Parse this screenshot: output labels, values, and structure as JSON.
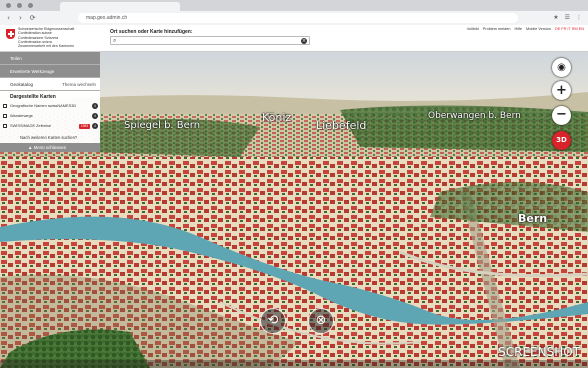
{
  "browser": {
    "url": "map.geo.admin.ch",
    "nav_back": "‹",
    "nav_forward": "›",
    "nav_reload": "⟳",
    "toolbar_icons": [
      "⋮",
      "★",
      "☰"
    ]
  },
  "header": {
    "confederation_lines": [
      "Schweizerische Eidgenossenschaft",
      "Confédération suisse",
      "Confederazione Svizzera",
      "Confederaziun svizra",
      "Zusammenarbeit mit den Kantonen"
    ],
    "search_label": "Ort suchen oder Karte hinzufügen:",
    "search_value": "",
    "top_links": [
      "Vollbild",
      "Problem melden",
      "Hilfe",
      "Mobile Version"
    ],
    "languages": "DE FR IT RM EN"
  },
  "panel": {
    "rows": [
      {
        "label": "Teilen"
      },
      {
        "label": "Erweiterte Werkzeuge"
      }
    ],
    "catalog_label": "Geokatalog",
    "catalog_action": "Thema wechseln",
    "layers_title": "Dargestellte Karten",
    "layers": [
      {
        "label": "Geografische Namen swissNAMES3D",
        "badge": ""
      },
      {
        "label": "Wanderwege",
        "badge": ""
      },
      {
        "label": "SWISSIMAGE Zeitreise",
        "badge": "1983"
      }
    ],
    "more_maps": "Nach weiteren Karten suchen?",
    "close_menu": "▲  Menü schliessen"
  },
  "places": [
    {
      "name": "Spiegel b. Bern"
    },
    {
      "name": "Köniz"
    },
    {
      "name": "Liebefeld"
    },
    {
      "name": "Oberwangen b. Bern"
    },
    {
      "name": "Bern"
    }
  ],
  "controls": {
    "locate": "◉",
    "zoom_in": "+",
    "zoom_out": "−",
    "threed": "3D"
  },
  "bottom_nav": {
    "rotate": "⟲",
    "compass": "⊗"
  },
  "watermark": "SCREENSHOT",
  "colors": {
    "swiss_red": "#d8232a",
    "panel_grey": "#8e8e8e",
    "roof_red": "#c8443a",
    "forest_green": "#3d6b2e"
  }
}
